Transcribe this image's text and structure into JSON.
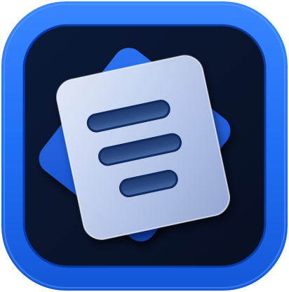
{
  "icon": {
    "name": "document-app-icon",
    "glyph": "stacked-document-lines-icon",
    "colors": {
      "frame_outer": "#1f6ff5",
      "frame_inner": "#0f4fcf",
      "tile_background": "#0a1630",
      "back_page": "#1e63e6",
      "front_page": "#b9c7ea",
      "line_fill": "#2e4a82",
      "line_stroke": "#0f2a5f"
    },
    "line_count": 3
  }
}
